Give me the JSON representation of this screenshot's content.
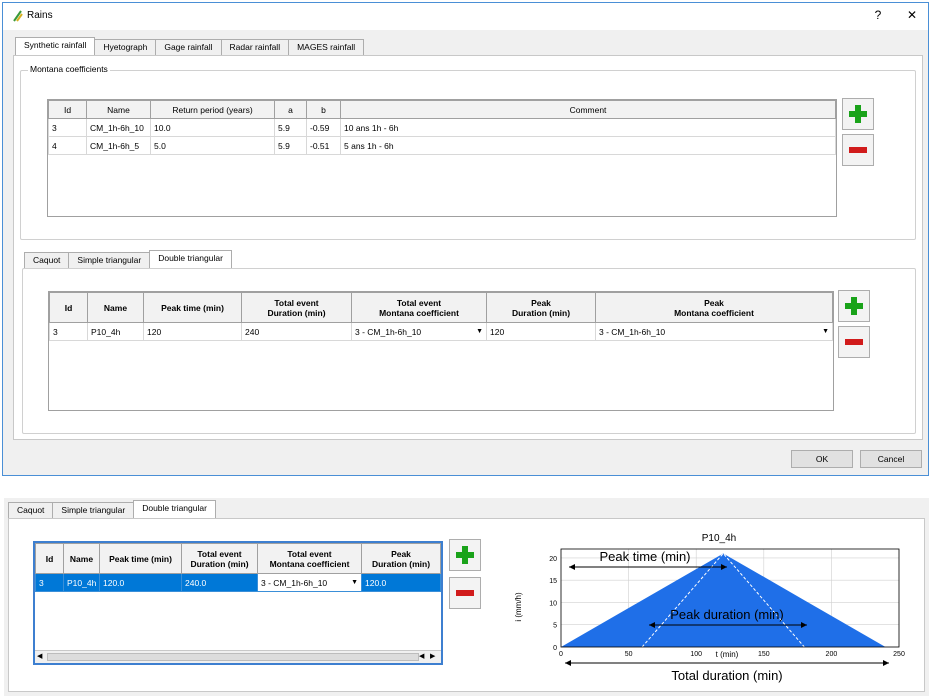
{
  "window": {
    "title": "Rains",
    "help_label": "?",
    "close_label": "✕",
    "main_tabs": [
      "Synthetic rainfall",
      "Hyetograph",
      "Gage rainfall",
      "Radar rainfall",
      "MAGES rainfall"
    ],
    "active_main_tab": "Synthetic rainfall",
    "montana_group_label": "Montana coefficients",
    "montana_table": {
      "headers": [
        "Id",
        "Name",
        "Return period (years)",
        "a",
        "b",
        "Comment"
      ],
      "rows": [
        [
          "3",
          "CM_1h-6h_10",
          "10.0",
          "5.9",
          "-0.59",
          "10 ans 1h - 6h"
        ],
        [
          "4",
          "CM_1h-6h_5",
          "5.0",
          "5.9",
          "-0.51",
          "5 ans 1h - 6h"
        ]
      ]
    },
    "sub_tabs": [
      "Caquot",
      "Simple triangular",
      "Double triangular"
    ],
    "active_sub_tab": "Double triangular",
    "double_table": {
      "headers": [
        "Id",
        "Name",
        "Peak time (min)",
        "Total event\nDuration (min)",
        "Total event\nMontana coefficient",
        "Peak\nDuration (min)",
        "Peak\nMontana coefficient"
      ],
      "rows": [
        [
          "3",
          "P10_4h",
          "120",
          "240",
          "3 - CM_1h-6h_10",
          "120",
          "3 - CM_1h-6h_10"
        ]
      ]
    },
    "ok_label": "OK",
    "cancel_label": "Cancel"
  },
  "bottom": {
    "sub_tabs": [
      "Caquot",
      "Simple triangular",
      "Double triangular"
    ],
    "active_sub_tab": "Double triangular",
    "table": {
      "headers": [
        "Id",
        "Name",
        "Peak time (min)",
        "Total event\nDuration (min)",
        "Total event\nMontana coefficient",
        "Peak\nDuration (min)"
      ],
      "rows": [
        [
          "3",
          "P10_4h",
          "120.0",
          "240.0",
          "3 - CM_1h-6h_10",
          "120.0"
        ]
      ]
    },
    "chart": {
      "title": "P10_4h",
      "xlabel": "t (min)",
      "ylabel": "i (mm/h)",
      "xticks": [
        "0",
        "50",
        "100",
        "150",
        "200",
        "250"
      ],
      "yticks": [
        "0",
        "5",
        "10",
        "15",
        "20"
      ],
      "annotation_peak_time": "Peak time (min)",
      "annotation_peak_duration": "Peak duration (min)",
      "annotation_total_duration": "Total duration (min)",
      "fill_color": "#1f6fe8"
    }
  },
  "chart_data": {
    "type": "area",
    "title": "P10_4h",
    "xlabel": "t (min)",
    "ylabel": "i (mm/h)",
    "xlim": [
      0,
      250
    ],
    "ylim": [
      0,
      22
    ],
    "x": [
      0,
      60,
      120,
      180,
      240
    ],
    "y": [
      0,
      10.5,
      21,
      10.5,
      0
    ]
  }
}
